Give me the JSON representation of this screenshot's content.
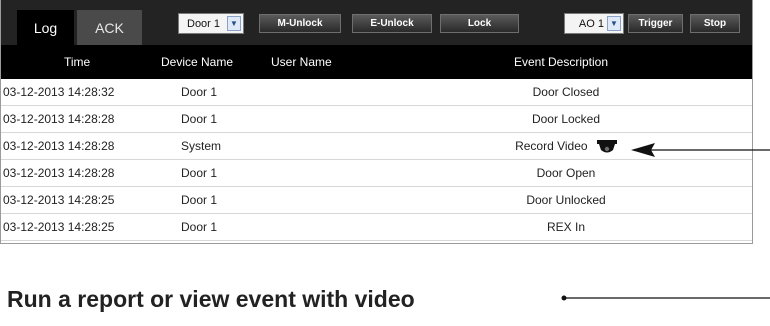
{
  "tabs": {
    "log": "Log",
    "ack": "ACK"
  },
  "toolbar": {
    "door_select": {
      "selected": "Door 1"
    },
    "buttons": {
      "m_unlock": "M-Unlock",
      "e_unlock": "E-Unlock",
      "lock": "Lock",
      "trigger": "Trigger",
      "stop": "Stop"
    },
    "ao_select": {
      "selected": "AO 1"
    }
  },
  "table": {
    "columns": {
      "time": "Time",
      "device": "Device Name",
      "user": "User Name",
      "event": "Event Description"
    },
    "rows": [
      {
        "time": "03-12-2013 14:28:32",
        "device": "Door 1",
        "user": "",
        "event": "Door Closed"
      },
      {
        "time": "03-12-2013 14:28:28",
        "device": "Door 1",
        "user": "",
        "event": "Door Locked"
      },
      {
        "time": "03-12-2013 14:28:28",
        "device": "System",
        "user": "",
        "event": "Record Video",
        "icon": "camera-icon"
      },
      {
        "time": "03-12-2013 14:28:28",
        "device": "Door 1",
        "user": "",
        "event": "Door Open"
      },
      {
        "time": "03-12-2013 14:28:25",
        "device": "Door 1",
        "user": "",
        "event": "Door Unlocked"
      },
      {
        "time": "03-12-2013 14:28:25",
        "device": "Door 1",
        "user": "",
        "event": "REX In"
      }
    ]
  },
  "caption": {
    "text": "Run a report or view event with video"
  },
  "colors": {
    "toolbar_bg": "#232323",
    "header_bg": "#000000",
    "row_divider": "#d8d8d8",
    "text": "#222222"
  }
}
